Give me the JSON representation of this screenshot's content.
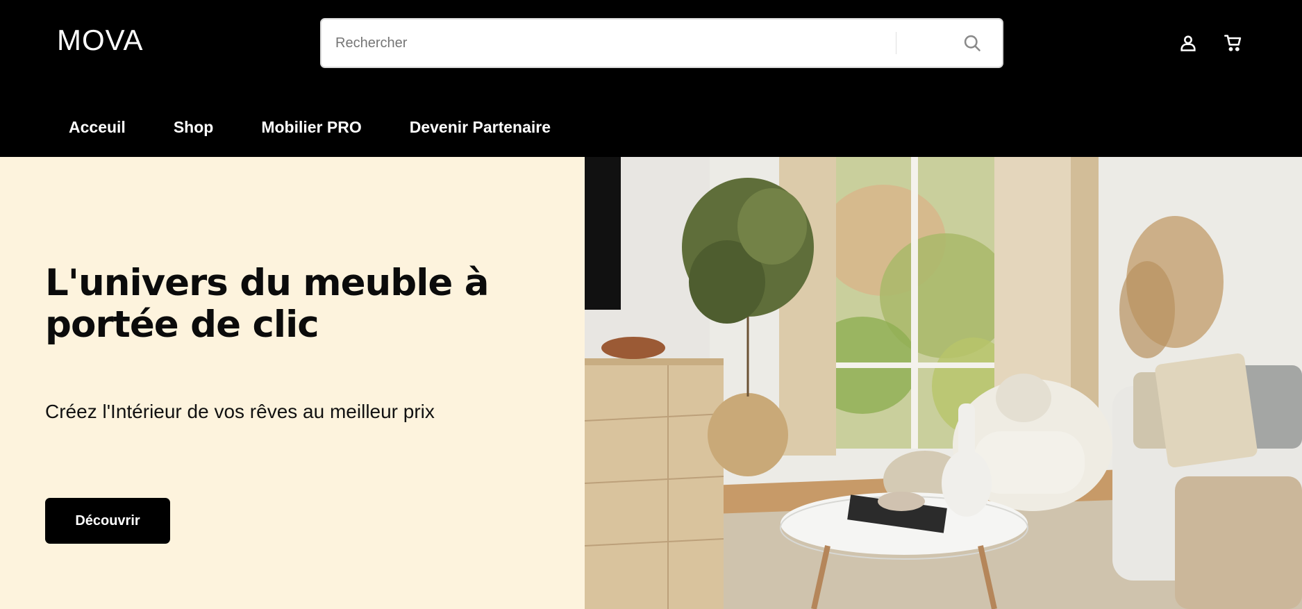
{
  "header": {
    "logo": "MOVA",
    "search": {
      "placeholder": "Rechercher",
      "value": ""
    },
    "icons": [
      "search-icon",
      "account-icon",
      "cart-icon"
    ]
  },
  "nav": {
    "items": [
      {
        "label": "Acceuil"
      },
      {
        "label": "Shop"
      },
      {
        "label": "Mobilier PRO"
      },
      {
        "label": "Devenir Partenaire"
      }
    ]
  },
  "hero": {
    "title_line1": "L'univers du meuble à",
    "title_line2": "portée de clic",
    "subtitle": "Créez l'Intérieur de vos rêves au meilleur prix",
    "cta": "Découvrir"
  },
  "colors": {
    "header_bg": "#000000",
    "hero_bg": "#fdf3dd",
    "button_bg": "#000000",
    "text": "#0b0b0b"
  }
}
